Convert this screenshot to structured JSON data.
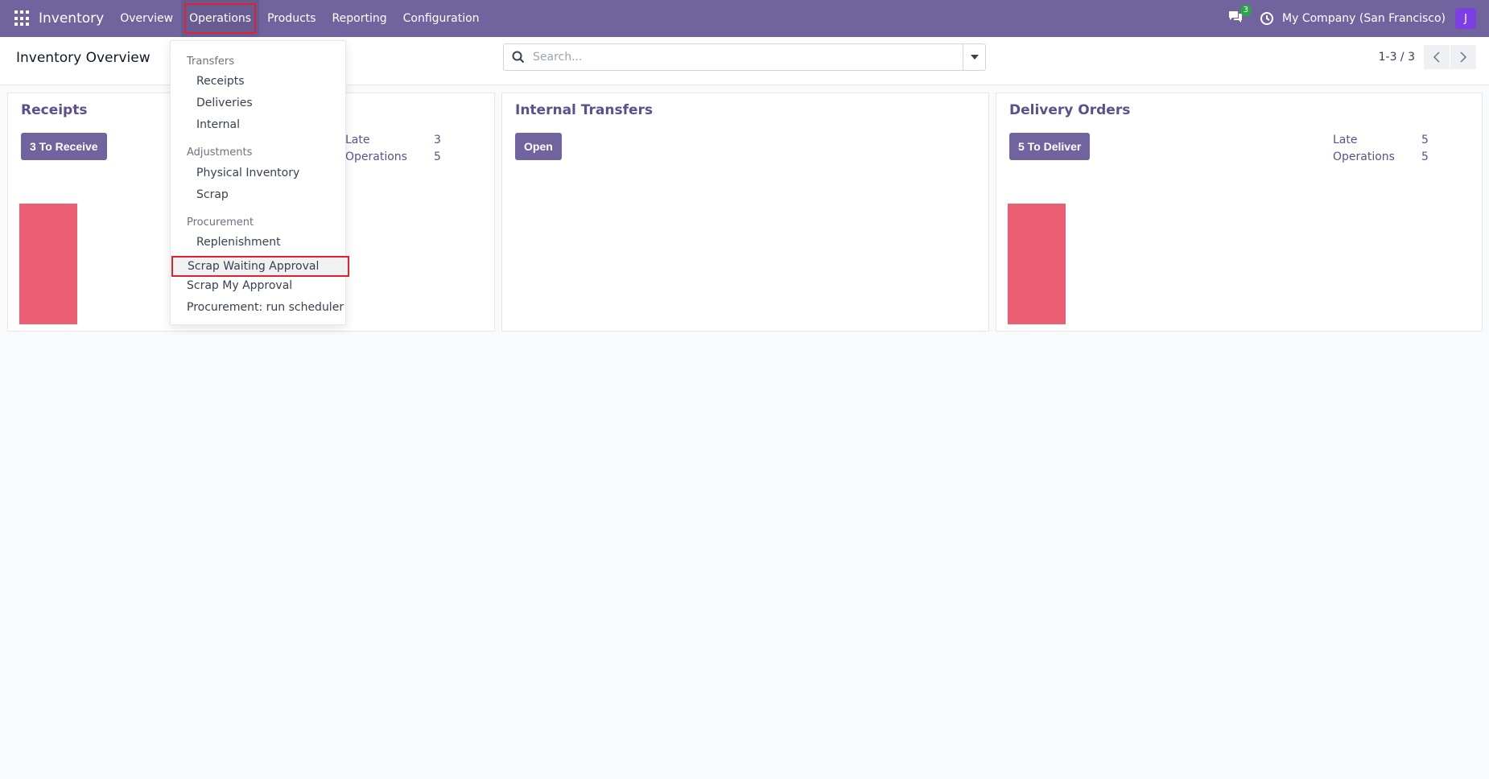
{
  "navbar": {
    "brand": "Inventory",
    "items": [
      {
        "label": "Overview"
      },
      {
        "label": "Operations"
      },
      {
        "label": "Products"
      },
      {
        "label": "Reporting"
      },
      {
        "label": "Configuration"
      }
    ],
    "chat_count": "3",
    "company": "My Company (San Francisco)",
    "avatar_letter": "J"
  },
  "control": {
    "title": "Inventory Overview",
    "search_placeholder": "Search...",
    "pager": "1-3 / 3"
  },
  "dropdown": {
    "sections": [
      {
        "header": "Transfers",
        "items": [
          "Receipts",
          "Deliveries",
          "Internal"
        ]
      },
      {
        "header": "Adjustments",
        "items": [
          "Physical Inventory",
          "Scrap"
        ]
      },
      {
        "header": "Procurement",
        "items": [
          "Replenishment"
        ]
      }
    ],
    "extra_items": [
      "Scrap Waiting Approval",
      "Scrap My Approval",
      "Procurement: run scheduler"
    ]
  },
  "cards": [
    {
      "title": "Receipts",
      "button": "3 To Receive",
      "stats": [
        {
          "label": "Late",
          "value": "3"
        },
        {
          "label": "Operations",
          "value": "5"
        }
      ],
      "bar_fraction": 1.0
    },
    {
      "title": "Internal Transfers",
      "button": "Open",
      "stats": []
    },
    {
      "title": "Delivery Orders",
      "button": "5 To Deliver",
      "stats": [
        {
          "label": "Late",
          "value": "5"
        },
        {
          "label": "Operations",
          "value": "5"
        }
      ],
      "bar_fraction": 1.0
    }
  ],
  "colors": {
    "navbar": "#71639e",
    "bar": "#ec5e72",
    "highlight_outline": "#e0212e"
  }
}
